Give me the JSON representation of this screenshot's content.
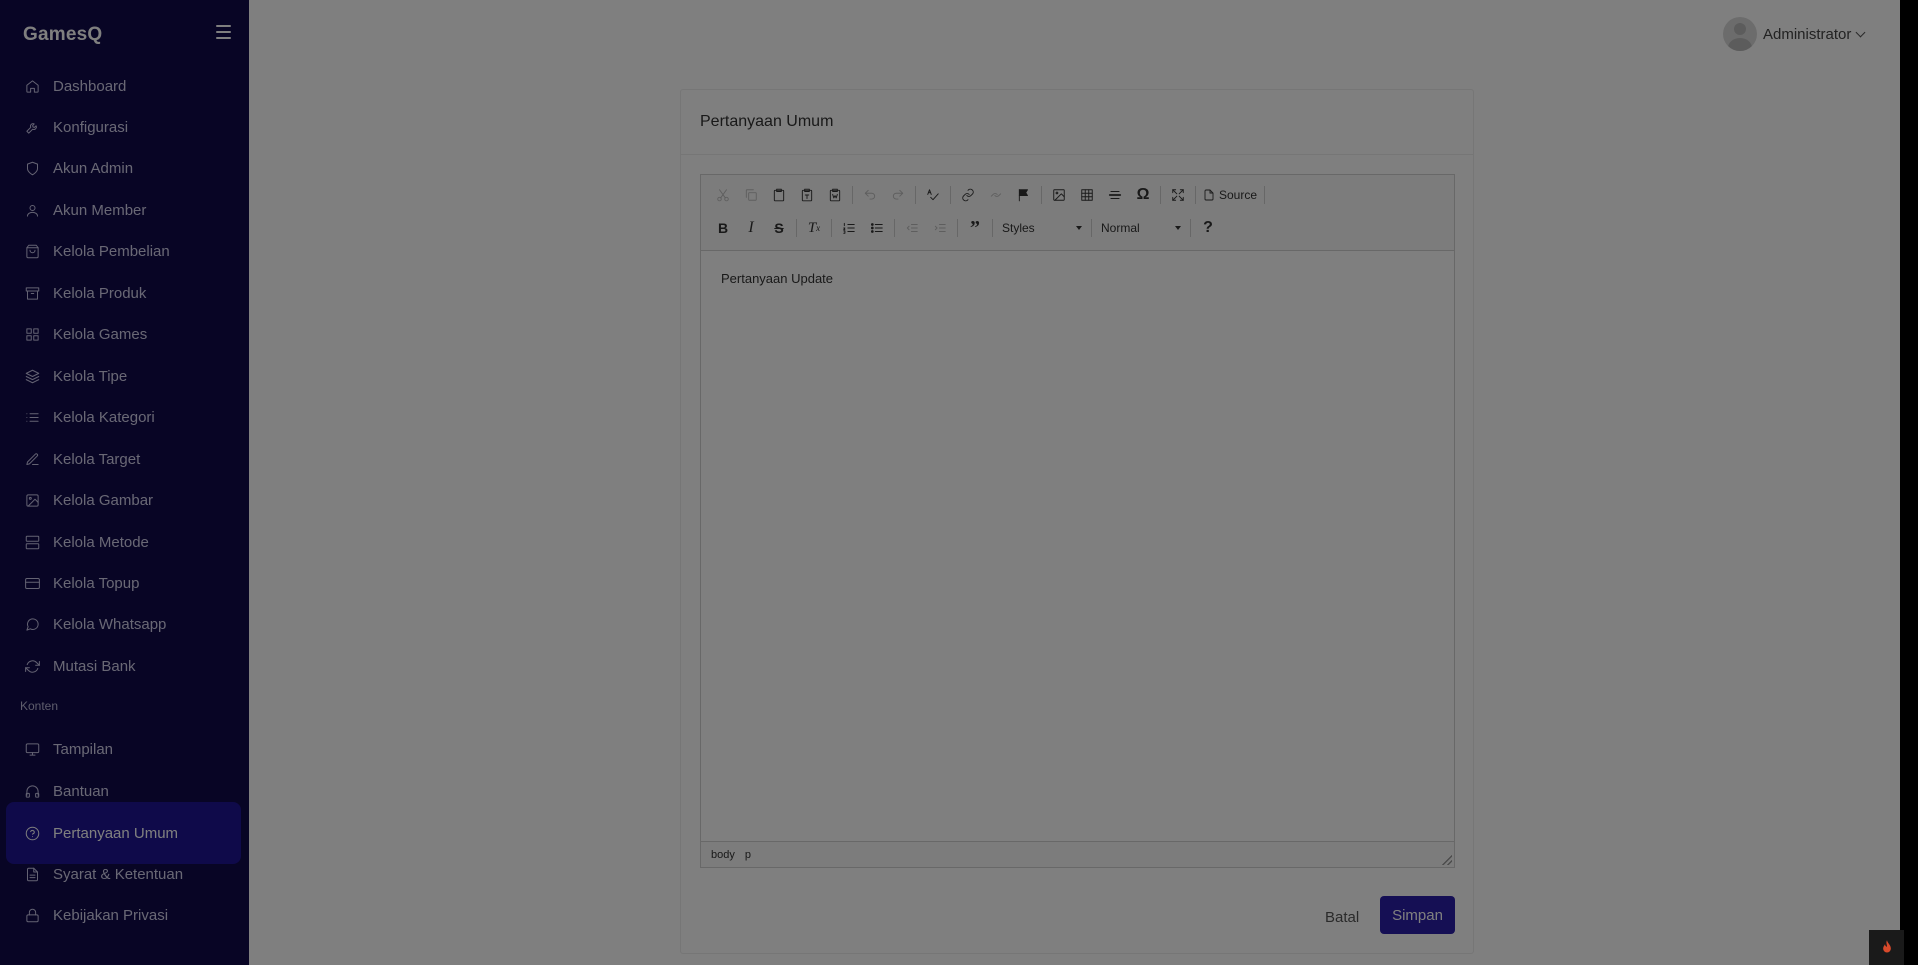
{
  "app": {
    "brand": "GamesQ"
  },
  "sidebar": {
    "items": [
      {
        "label": "Dashboard",
        "icon": "home-icon"
      },
      {
        "label": "Konfigurasi",
        "icon": "wrench-icon"
      },
      {
        "label": "Akun Admin",
        "icon": "shield-icon"
      },
      {
        "label": "Akun Member",
        "icon": "user-icon"
      },
      {
        "label": "Kelola Pembelian",
        "icon": "shopping-bag-icon"
      },
      {
        "label": "Kelola Produk",
        "icon": "archive-icon"
      },
      {
        "label": "Kelola Games",
        "icon": "grid-icon"
      },
      {
        "label": "Kelola Tipe",
        "icon": "layers-icon"
      },
      {
        "label": "Kelola Kategori",
        "icon": "list-icon"
      },
      {
        "label": "Kelola Target",
        "icon": "edit-icon"
      },
      {
        "label": "Kelola Gambar",
        "icon": "image-icon"
      },
      {
        "label": "Kelola Metode",
        "icon": "server-icon"
      },
      {
        "label": "Kelola Topup",
        "icon": "credit-card-icon"
      },
      {
        "label": "Kelola Whatsapp",
        "icon": "message-circle-icon"
      },
      {
        "label": "Mutasi Bank",
        "icon": "refresh-icon"
      }
    ],
    "section_label": "Konten",
    "content_items": [
      {
        "label": "Tampilan",
        "icon": "monitor-icon"
      },
      {
        "label": "Bantuan",
        "icon": "headphones-icon"
      },
      {
        "label": "Pertanyaan Umum",
        "icon": "help-circle-icon",
        "active": true
      },
      {
        "label": "Syarat & Ketentuan",
        "icon": "file-text-icon"
      },
      {
        "label": "Kebijakan Privasi",
        "icon": "lock-icon"
      }
    ]
  },
  "header": {
    "user_name": "Administrator"
  },
  "card": {
    "title": "Pertanyaan Umum"
  },
  "editor": {
    "source_label": "Source",
    "styles_label": "Styles",
    "format_label": "Normal",
    "content": "Pertanyaan Update",
    "path": [
      "body",
      "p"
    ]
  },
  "actions": {
    "cancel_label": "Batal",
    "save_label": "Simpan"
  },
  "colors": {
    "sidebar_bg": "#110a4a",
    "active_item": "#1e1494",
    "primary_button": "#2a1ea8"
  }
}
